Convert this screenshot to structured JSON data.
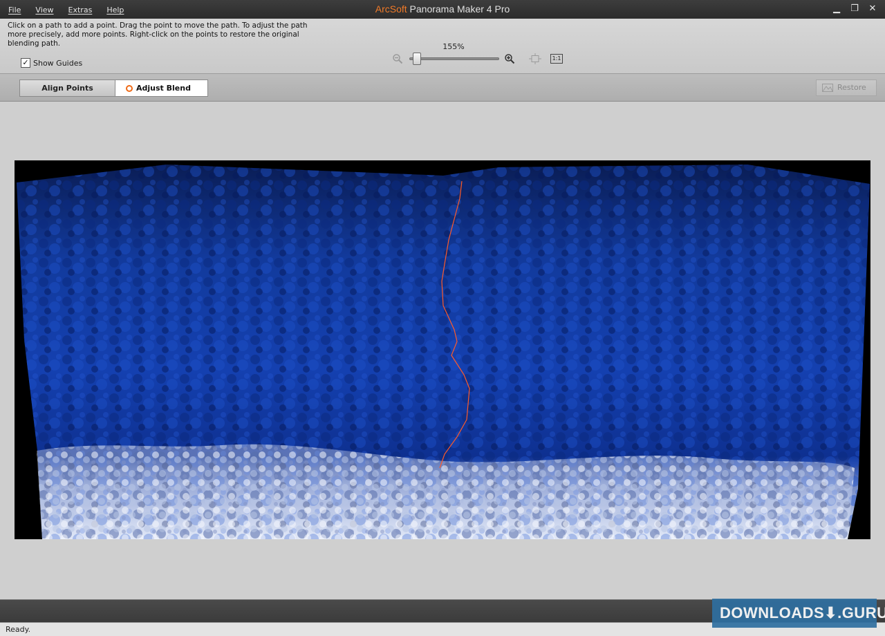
{
  "window": {
    "brand": "ArcSoft",
    "title": "Panorama Maker 4 Pro",
    "brand_color": "#f07a28"
  },
  "menu": {
    "file": "File",
    "view": "View",
    "extras": "Extras",
    "help": "Help"
  },
  "window_controls": {
    "minimize": "▁",
    "maximize": "❐",
    "close": "✕"
  },
  "toolbar": {
    "hint": "Click on a path to add a point. Drag the point to move the path. To adjust the path more precisely, add more points. Right-click on the points to restore the original blending path.",
    "show_guides_label": "Show Guides",
    "show_guides_checked": "✓",
    "zoom_level": "155%",
    "actual_size_label": "1:1",
    "zoom_fraction": 0.05
  },
  "modes": {
    "align_points": "Align Points",
    "adjust_blend": "Adjust Blend",
    "active": "adjust_blend",
    "active_color": "#ef6a16"
  },
  "restore_label": "Restore",
  "status": {
    "text": "Ready."
  },
  "watermark": {
    "text": "DOWNLOADS⬇.GURU"
  },
  "icons": {
    "zoom_out": "zoom-out-icon",
    "zoom_in": "zoom-in-icon",
    "fit": "fit-to-window-icon",
    "actual": "actual-size-icon",
    "restore": "restore-icon"
  }
}
